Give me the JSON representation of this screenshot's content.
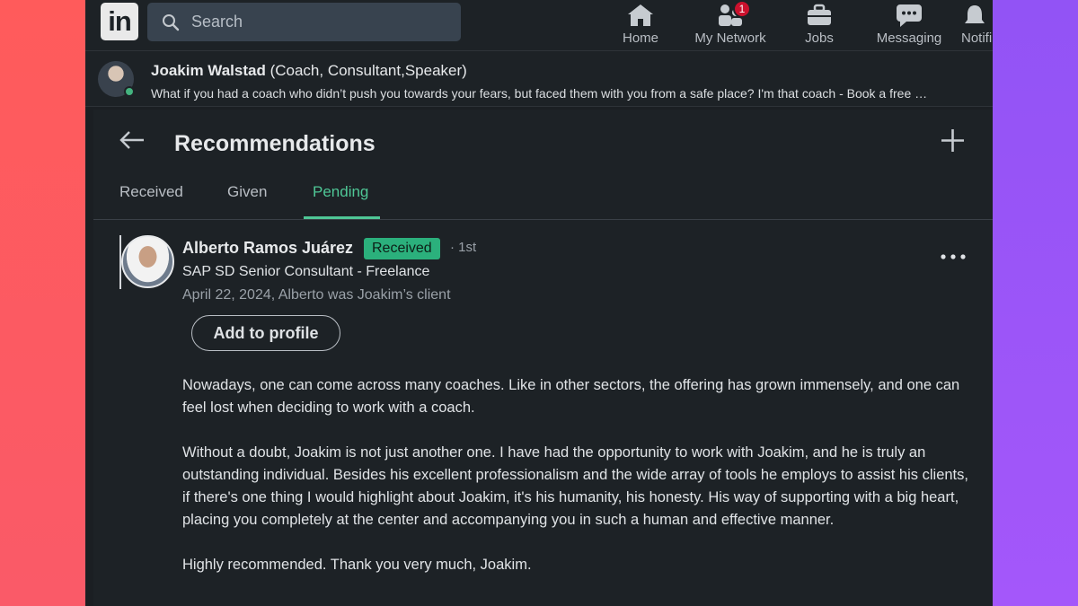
{
  "nav": {
    "logo": "in",
    "search_placeholder": "Search",
    "items": [
      {
        "label": "Home",
        "icon": "home-icon"
      },
      {
        "label": "My Network",
        "icon": "network-icon",
        "badge": "1"
      },
      {
        "label": "Jobs",
        "icon": "briefcase-icon"
      },
      {
        "label": "Messaging",
        "icon": "message-icon"
      },
      {
        "label": "Notifi",
        "icon": "bell-icon"
      }
    ]
  },
  "profile_strip": {
    "name": "Joakim Walstad",
    "role": " (Coach, Consultant,Speaker)",
    "headline": "What if you had a coach who didn’t push you towards your fears, but faced them with you from a safe place? I'm that coach - Book a free …"
  },
  "recommendations": {
    "title": "Recommendations",
    "tabs": [
      {
        "label": "Received",
        "active": false
      },
      {
        "label": "Given",
        "active": false
      },
      {
        "label": "Pending",
        "active": true
      }
    ],
    "item": {
      "name": "Alberto Ramos Juárez",
      "badge": "Received",
      "degree": "· 1st",
      "title": "SAP SD Senior Consultant - Freelance",
      "date_relation": "April 22, 2024, Alberto was Joakim’s client",
      "action": "Add to profile",
      "paragraphs": [
        "Nowadays, one can come across many coaches. Like in other sectors, the offering has grown immensely, and one can feel lost when deciding to work with a coach.",
        "Without a doubt, Joakim is not just another one. I have had the opportunity to work with Joakim, and he is truly an outstanding individual. Besides his excellent professionalism and the wide array of tools he employs to assist his clients, if there's one thing I would highlight about Joakim, it's his humanity, his honesty. His way of supporting with a big heart, placing you completely at the center and accompanying you in such a human and effective manner.",
        "Highly recommended. Thank you very much, Joakim."
      ]
    }
  },
  "colors": {
    "accent": "#4fc796",
    "badge_green": "#2bb07c",
    "notification_red": "#cb112d",
    "background": "#1d2226"
  }
}
